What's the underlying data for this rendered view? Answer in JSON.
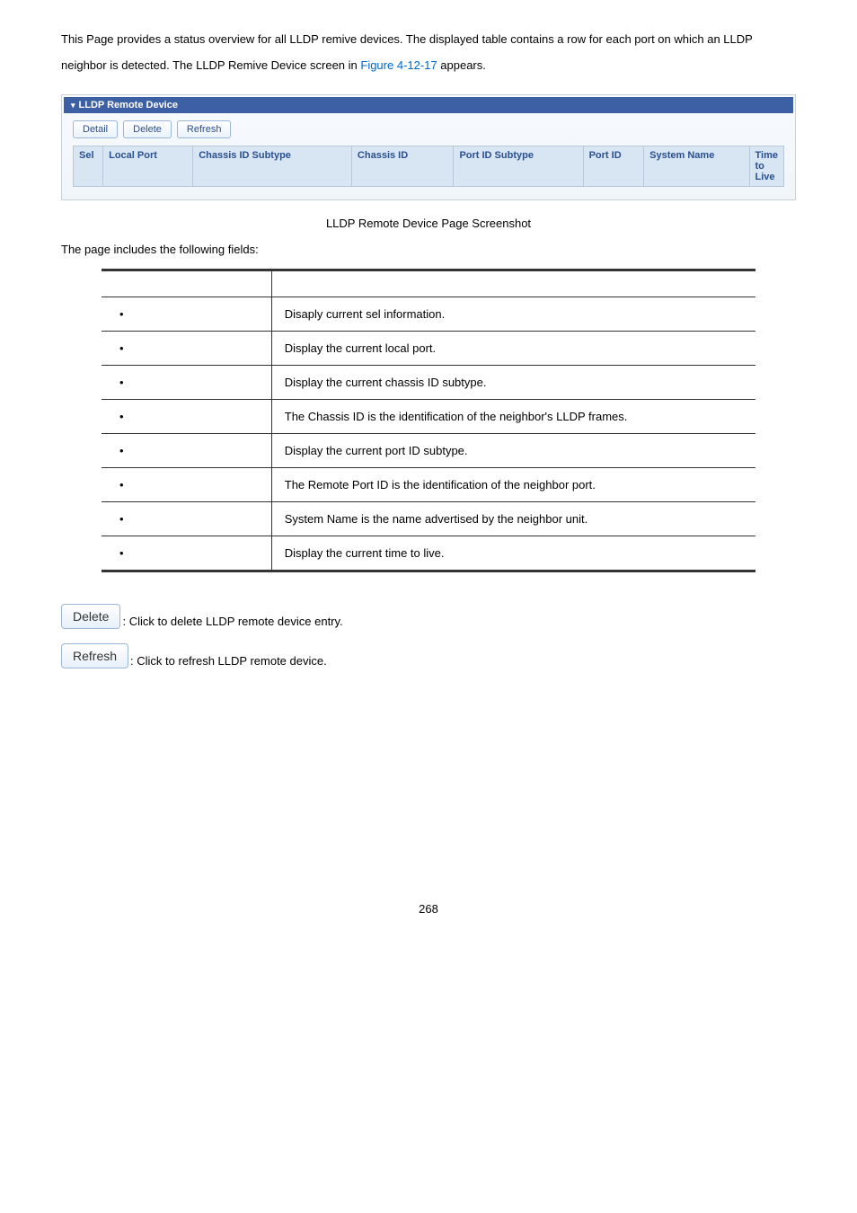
{
  "intro": {
    "part1": "This Page provides a status overview for all LLDP remive devices. The displayed table contains a row for each port on which an LLDP neighbor is detected. The LLDP Remive Device screen in ",
    "link": "Figure 4-12-17",
    "part2": " appears."
  },
  "panel": {
    "title": "LLDP Remote Device",
    "buttons": {
      "detail": "Detail",
      "delete": "Delete",
      "refresh": "Refresh"
    },
    "cols": {
      "sel": "Sel",
      "local_port": "Local Port",
      "chassis_sub": "Chassis ID Subtype",
      "chassis_id": "Chassis ID",
      "port_sub": "Port ID Subtype",
      "port_id": "Port ID",
      "system_name": "System Name",
      "ttl": "Time to Live"
    }
  },
  "caption": "LLDP Remote Device Page Screenshot",
  "fields_intro": "The page includes the following fields:",
  "fields": [
    {
      "desc": "Disaply current sel information."
    },
    {
      "desc": "Display the current local port."
    },
    {
      "desc": "Display the current chassis ID subtype."
    },
    {
      "desc": "The Chassis ID is the identification of the neighbor's LLDP frames."
    },
    {
      "desc": "Display the current port ID subtype."
    },
    {
      "desc": "The Remote Port ID is the identification of the neighbor port."
    },
    {
      "desc": "System Name is the name advertised by the neighbor unit."
    },
    {
      "desc": "Display the current time to live."
    }
  ],
  "action_buttons": {
    "delete": {
      "label": "Delete",
      "desc": ": Click to delete LLDP remote device entry."
    },
    "refresh": {
      "label": "Refresh",
      "desc": ": Click to refresh LLDP remote device."
    }
  },
  "page_number": "268"
}
